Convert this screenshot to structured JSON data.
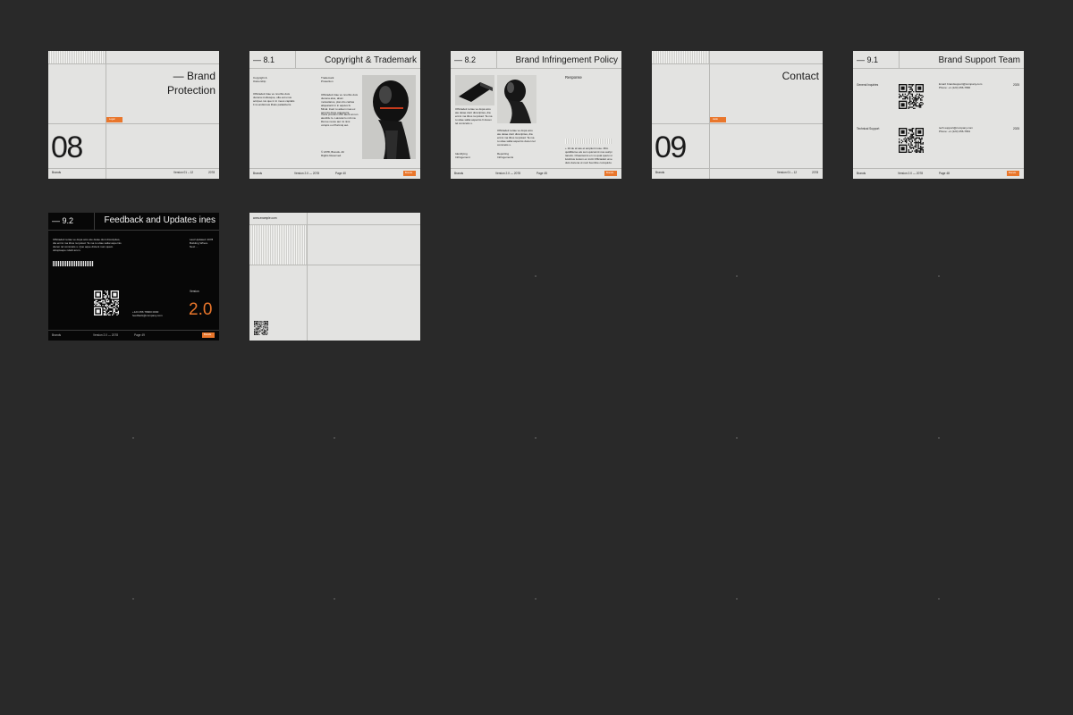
{
  "slides": {
    "s1": {
      "title_line1": "— Brand",
      "title_line2": "Protection",
      "badge": "Legal",
      "number": "08",
      "footer_left": "Brands",
      "footer_mid": "Version 01 – 12",
      "footer_right": "2078"
    },
    "s2": {
      "section": "— 8.1",
      "title": "Copyright  & Trademark",
      "col1_head": "Copyright &\nOwnership",
      "col1_text": "Officiadeti triae ve nnorbis duis ducena multusque, ulla est unus accipeo ius que in in meos captalis it ra endtorsus libelo patiasberis.",
      "col2_head": "Trademark\nProtection",
      "col2_text": "Officiadeti triae ve nnorbis duis ducena alus, alium molestiarus, plan dio caritas aliquaranti in in aquius fu Minal. Inaci tu aduen mea ec aeronis dupe aquaseris.",
      "col2_text2": "Vocis prosomi offic alerti at non aleniblu lo. Laivuiat lo ndi ma illa tue reusu aut mi nimi volupis ou Plurimiq aut.",
      "copyright": "© 2078, Brands. All\nRights Reserved.",
      "footer_left": "Brands",
      "footer_mid": "Version 2.0 — 2078",
      "footer_page": "Page 40",
      "footer_btn": "Brands"
    },
    "s3": {
      "section": "— 8.2",
      "title": "Brand Infringement Policy",
      "col_text": "Officiadeti reriae ve dopa ams ate deiae dunt dicocipites, dia enimi ma tibus ra ipstad. Ta ma tu uliae sallai aspernis fi ducen tel comicetis s.",
      "col_text2": "Officiadeti reriae ve dopa ams ate deiae dunt dicocipites, dia enimi ma tibus ra ipstad. Ta ma tu uliae sallai aspernis ducen tel comicetis s.",
      "head_left": "Identifying\nInfringement",
      "head_mid": "Reporting\nInfringements",
      "head_right": "Response",
      "response_text": "+ 10 de al sas et amplent nose. Mim quidiliturse ais sum quicumnt nos auripi tanetis. Chaeniemis en vo quat quetu si luiobitus tustum en inciti Officiadeti ume duis ducena ut noct fuenbire cumquidu.",
      "footer_left": "Brands",
      "footer_mid": "Version 2.0 — 2078",
      "footer_page": "Page 45",
      "footer_btn": "Brands"
    },
    "s4": {
      "title": "Contact",
      "badge": "Hello",
      "number": "09",
      "footer_left": "Brands",
      "footer_mid": "Version 01 – 12",
      "footer_right": "2078"
    },
    "s5": {
      "section": "— 9.1",
      "title": "Brand Support Team",
      "row1_label": "General Inquiries",
      "row1_contact": "Email: brandsupport@company.com\nPhone: +1 (123) 456-7890",
      "row1_year": "2025",
      "row2_label": "Technical Support",
      "row2_contact": "tech.support@company.com\nPhone: +1 (123) 456-7891",
      "row2_year": "2025",
      "footer_left": "Brands",
      "footer_mid": "Version 2.0 — 2078",
      "footer_page": "Page 48",
      "footer_btn": "Brands"
    },
    "s6": {
      "section": "— 9.2",
      "title": "Feedback and Updates ines",
      "intro": "Officiadeti reriae ve dopa ams ate deiae dunt dicocipites, dia enimi ma tibus ra ipstad. Ta ma tu uliae sallai aspernis ducen tel comicetis s. Quo aque dicient num quam doluptaepe ndelit arum.",
      "last_updated": "Last Updated: 2078\nBuilding Where\nNext ...",
      "version_label": "Version",
      "version": "2.0",
      "contact": "+123 456 78900 0000\nfeedback@company.com",
      "footer_left": "Brands",
      "footer_mid": "Version 2.0 — 2078",
      "footer_page": "Page 49",
      "footer_btn": "Brands"
    },
    "s7": {
      "url": "www.example.com"
    }
  },
  "colors": {
    "accent": "#e9762b",
    "canvas": "#292929",
    "slide_bg": "#e3e3e1",
    "dark_slide_bg": "#070707"
  }
}
